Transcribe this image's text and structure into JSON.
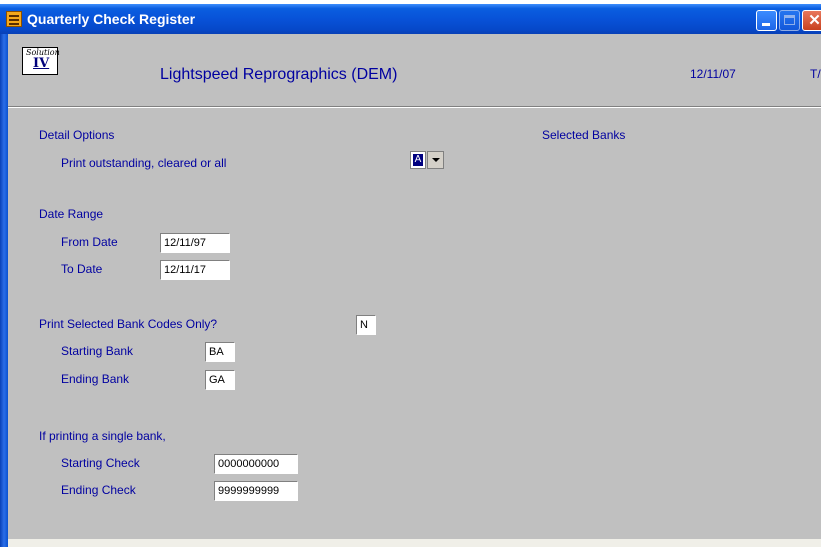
{
  "window": {
    "title": "Quarterly Check Register"
  },
  "header": {
    "logo_top": "Solution",
    "logo_roman": "IV",
    "company": "Lightspeed Reprographics (DEM)",
    "date": "12/11/07",
    "user": "T/"
  },
  "detail_options": {
    "heading": "Detail Options",
    "prompt": "Print outstanding, cleared or all",
    "value": "A"
  },
  "selected_banks": {
    "heading": "Selected Banks"
  },
  "date_range": {
    "heading": "Date Range",
    "from_label": "From Date",
    "from_value": "12/11/97",
    "to_label": "To Date",
    "to_value": "12/11/17"
  },
  "bank_codes": {
    "prompt": "Print Selected Bank Codes Only?",
    "value": "N",
    "start_label": "Starting Bank",
    "start_value": "BA",
    "end_label": "Ending Bank",
    "end_value": "GA"
  },
  "single_bank": {
    "heading": "If printing a single bank,",
    "start_label": "Starting Check",
    "start_value": "0000000000",
    "end_label": "Ending Check",
    "end_value": "9999999999"
  }
}
